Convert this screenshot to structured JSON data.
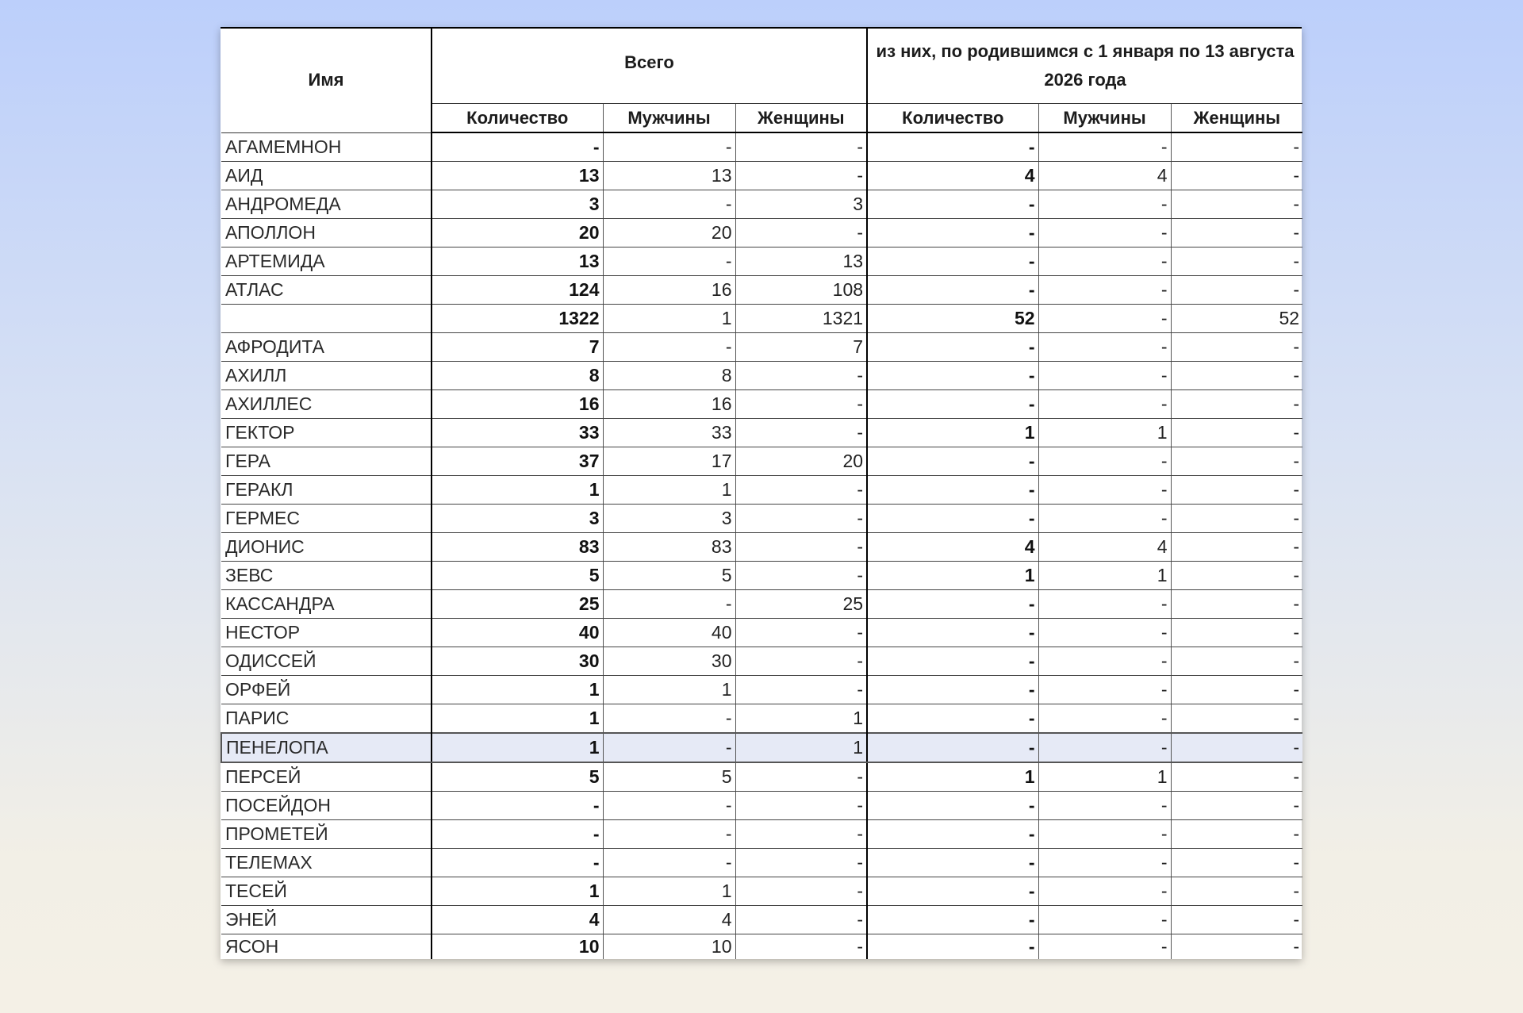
{
  "table": {
    "headers": {
      "name": "Имя",
      "total_group": "Всего",
      "born_group": "из них, по родившимся с 1 января по 13 августа 2026 года",
      "sub": [
        "Количество",
        "Мужчины",
        "Женщины",
        "Количество",
        "Мужчины",
        "Женщины"
      ]
    },
    "selected_row": 21,
    "rows": [
      {
        "name": "АГАМЕМНОН",
        "cells": [
          "-",
          "-",
          "-",
          "-",
          "-",
          "-"
        ]
      },
      {
        "name": "АИД",
        "cells": [
          "13",
          "13",
          "-",
          "4",
          "4",
          "-"
        ]
      },
      {
        "name": "АНДРОМЕДА",
        "cells": [
          "3",
          "-",
          "3",
          "-",
          "-",
          "-"
        ]
      },
      {
        "name": "АПОЛЛОН",
        "cells": [
          "20",
          "20",
          "-",
          "-",
          "-",
          "-"
        ]
      },
      {
        "name": "АРТЕМИДА",
        "cells": [
          "13",
          "-",
          "13",
          "-",
          "-",
          "-"
        ]
      },
      {
        "name": "АТЛАС",
        "cells": [
          "124",
          "16",
          "108",
          "-",
          "-",
          "-"
        ]
      },
      {
        "name": "",
        "cells": [
          "1322",
          "1",
          "1321",
          "52",
          "-",
          "52"
        ]
      },
      {
        "name": "АФРОДИТА",
        "cells": [
          "7",
          "-",
          "7",
          "-",
          "-",
          "-"
        ]
      },
      {
        "name": "АХИЛЛ",
        "cells": [
          "8",
          "8",
          "-",
          "-",
          "-",
          "-"
        ]
      },
      {
        "name": "АХИЛЛЕС",
        "cells": [
          "16",
          "16",
          "-",
          "-",
          "-",
          "-"
        ]
      },
      {
        "name": "ГЕКТОР",
        "cells": [
          "33",
          "33",
          "-",
          "1",
          "1",
          "-"
        ]
      },
      {
        "name": "ГЕРА",
        "cells": [
          "37",
          "17",
          "20",
          "-",
          "-",
          "-"
        ]
      },
      {
        "name": "ГЕРАКЛ",
        "cells": [
          "1",
          "1",
          "-",
          "-",
          "-",
          "-"
        ]
      },
      {
        "name": "ГЕРМЕС",
        "cells": [
          "3",
          "3",
          "-",
          "-",
          "-",
          "-"
        ]
      },
      {
        "name": "ДИОНИС",
        "cells": [
          "83",
          "83",
          "-",
          "4",
          "4",
          "-"
        ]
      },
      {
        "name": "ЗЕВС",
        "cells": [
          "5",
          "5",
          "-",
          "1",
          "1",
          "-"
        ]
      },
      {
        "name": "КАССАНДРА",
        "cells": [
          "25",
          "-",
          "25",
          "-",
          "-",
          "-"
        ]
      },
      {
        "name": "НЕСТОР",
        "cells": [
          "40",
          "40",
          "-",
          "-",
          "-",
          "-"
        ]
      },
      {
        "name": "ОДИССЕЙ",
        "cells": [
          "30",
          "30",
          "-",
          "-",
          "-",
          "-"
        ]
      },
      {
        "name": "ОРФЕЙ",
        "cells": [
          "1",
          "1",
          "-",
          "-",
          "-",
          "-"
        ]
      },
      {
        "name": "ПАРИС",
        "cells": [
          "1",
          "-",
          "1",
          "-",
          "-",
          "-"
        ]
      },
      {
        "name": "ПЕНЕЛОПА",
        "cells": [
          "1",
          "-",
          "1",
          "-",
          "-",
          "-"
        ]
      },
      {
        "name": "ПЕРСЕЙ",
        "cells": [
          "5",
          "5",
          "-",
          "1",
          "1",
          "-"
        ]
      },
      {
        "name": "ПОСЕЙДОН",
        "cells": [
          "-",
          "-",
          "-",
          "-",
          "-",
          "-"
        ]
      },
      {
        "name": "ПРОМЕТЕЙ",
        "cells": [
          "-",
          "-",
          "-",
          "-",
          "-",
          "-"
        ]
      },
      {
        "name": "ТЕЛЕМАХ",
        "cells": [
          "-",
          "-",
          "-",
          "-",
          "-",
          "-"
        ]
      },
      {
        "name": "ТЕСЕЙ",
        "cells": [
          "1",
          "1",
          "-",
          "-",
          "-",
          "-"
        ]
      },
      {
        "name": "ЭНЕЙ",
        "cells": [
          "4",
          "4",
          "-",
          "-",
          "-",
          "-"
        ]
      },
      {
        "name": "ЯСОН",
        "cells": [
          "10",
          "10",
          "-",
          "-",
          "-",
          "-"
        ]
      }
    ]
  }
}
